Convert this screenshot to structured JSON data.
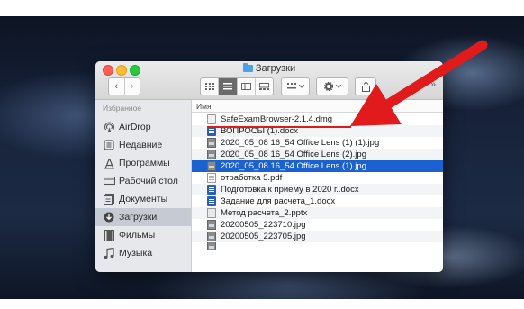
{
  "window": {
    "title": "Загрузки",
    "more_glyph": "»"
  },
  "toolbar": {
    "back": "‹",
    "forward": "›"
  },
  "sidebar": {
    "heading": "Избранное",
    "items": [
      {
        "label": "AirDrop",
        "icon": "airdrop-icon"
      },
      {
        "label": "Недавние",
        "icon": "recents-icon"
      },
      {
        "label": "Программы",
        "icon": "applications-icon"
      },
      {
        "label": "Рабочий стол",
        "icon": "desktop-icon"
      },
      {
        "label": "Документы",
        "icon": "documents-icon"
      },
      {
        "label": "Загрузки",
        "icon": "downloads-icon",
        "selected": true
      },
      {
        "label": "Фильмы",
        "icon": "movies-icon"
      },
      {
        "label": "Музыка",
        "icon": "music-icon"
      }
    ]
  },
  "list": {
    "column_name": "Имя",
    "files": [
      {
        "name": "SafeExamBrowser-2.1.4.dmg",
        "kind": "dmg"
      },
      {
        "name": "ВОПРОСЫ (1).docx",
        "kind": "docx"
      },
      {
        "name": "2020_05_08 16_54 Office Lens (1) (1).jpg",
        "kind": "img"
      },
      {
        "name": "2020_05_08 16_54 Office Lens (2).jpg",
        "kind": "img"
      },
      {
        "name": "2020_05_08 16_54 Office Lens (1).jpg",
        "kind": "img",
        "selected": true
      },
      {
        "name": "отработка 5.pdf",
        "kind": "pdf"
      },
      {
        "name": "Подготовка к приему в 2020 г..docx",
        "kind": "docx"
      },
      {
        "name": "Задание для расчета_1.docx",
        "kind": "docx"
      },
      {
        "name": "Метод расчета_2.pptx",
        "kind": "pptx"
      },
      {
        "name": "20200505_223710.jpg",
        "kind": "img"
      },
      {
        "name": "20200505_223705.jpg",
        "kind": "img"
      }
    ]
  },
  "annotation": {
    "color": "#e11b1b"
  },
  "colors": {
    "selection": "#1b62d0",
    "sidebar_selected": "#c6cbd3"
  }
}
